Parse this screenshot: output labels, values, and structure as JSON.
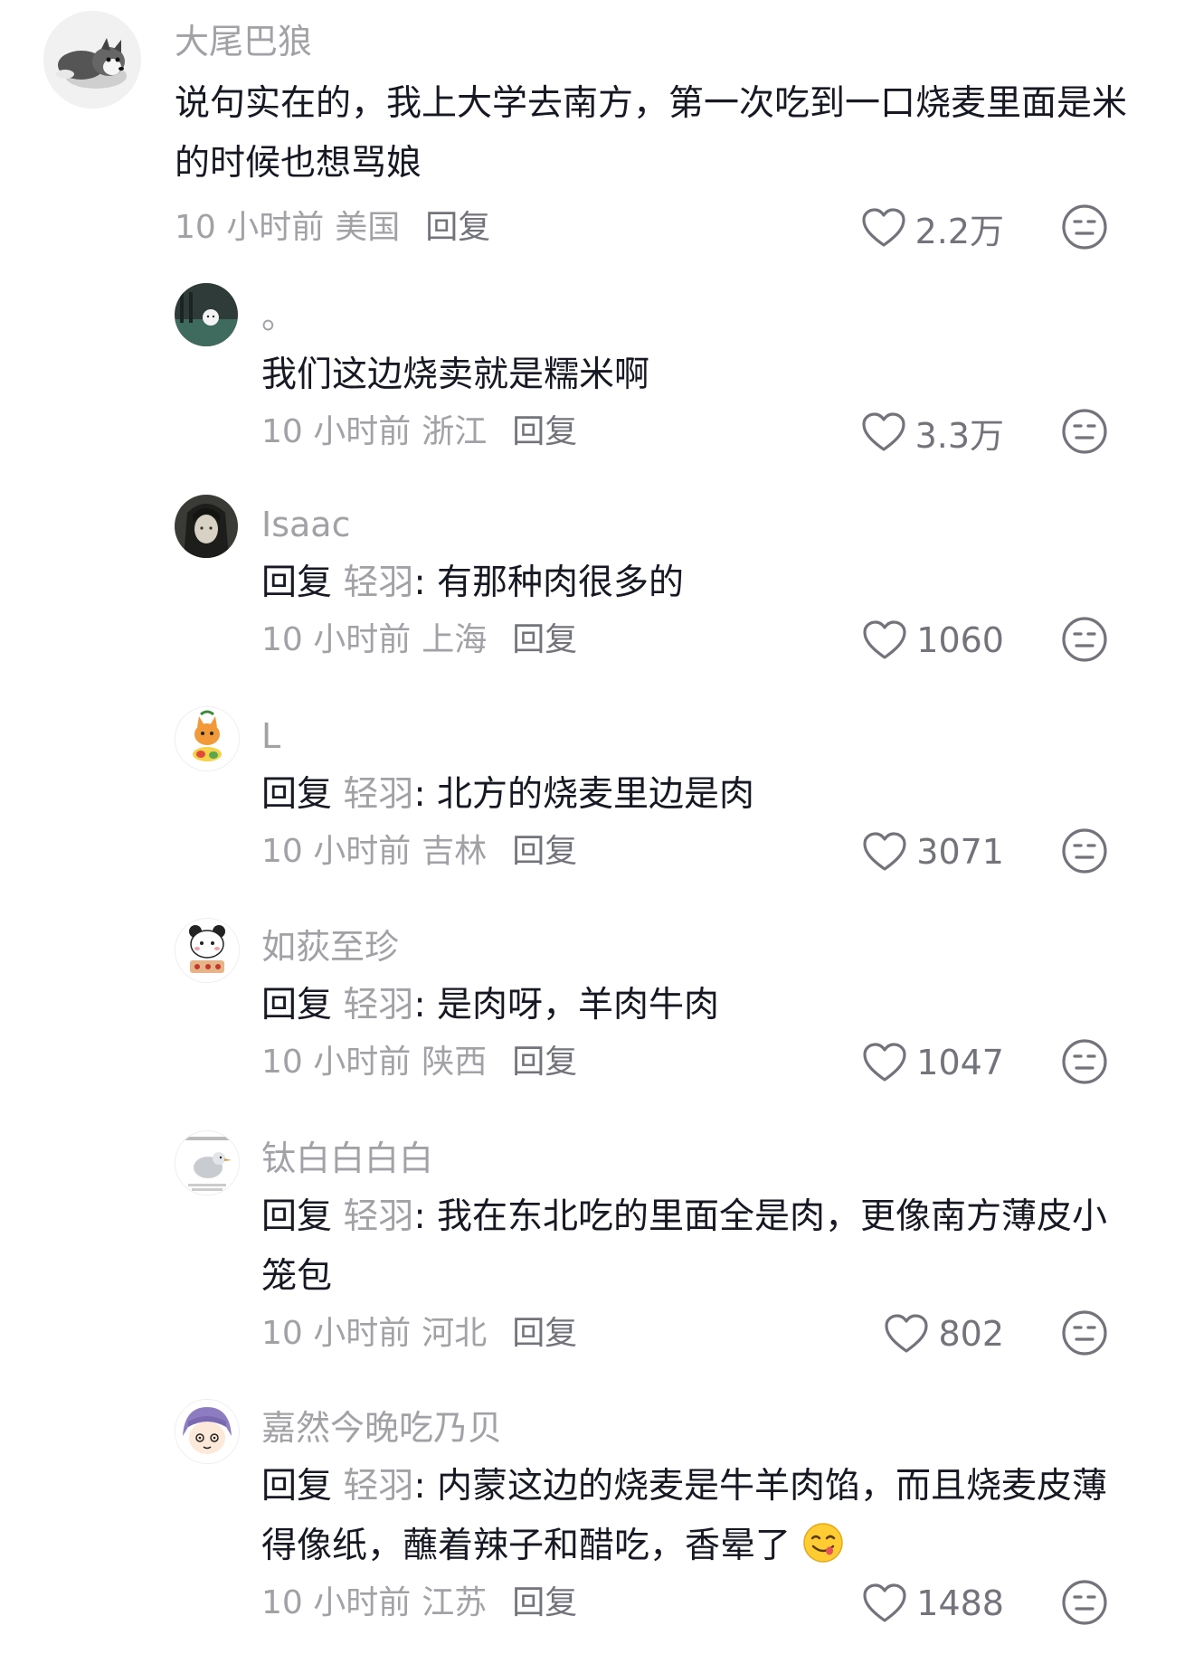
{
  "comments": [
    {
      "username": "大尾巴狼",
      "text": "说句实在的，我上大学去南方，第一次吃到一口烧麦里面是米的时候也想骂娘",
      "time": "10 小时前",
      "location": "美国",
      "reply_label": "回复",
      "likes": "2.2万",
      "avatar_icon": "husky-plush-avatar"
    },
    {
      "username": "。",
      "text": "我们这边烧卖就是糯米啊",
      "time": "10 小时前",
      "location": "浙江",
      "reply_label": "回复",
      "likes": "3.3万",
      "avatar_icon": "dark-room-avatar"
    },
    {
      "username": "Isaac",
      "reply_prefix": "回复",
      "reply_to": "轻羽",
      "colon": ":",
      "text": "有那种肉很多的",
      "time": "10 小时前",
      "location": "上海",
      "reply_label": "回复",
      "likes": "1060",
      "avatar_icon": "anime-girl-avatar"
    },
    {
      "username": "L",
      "reply_prefix": "回复",
      "reply_to": "轻羽",
      "colon": ":",
      "text": "北方的烧麦里边是肉",
      "time": "10 小时前",
      "location": "吉林",
      "reply_label": "回复",
      "likes": "3071",
      "avatar_icon": "orange-cat-avatar"
    },
    {
      "username": "如荻至珍",
      "reply_prefix": "回复",
      "reply_to": "轻羽",
      "colon": ":",
      "text": "是肉呀，羊肉牛肉",
      "time": "10 小时前",
      "location": "陕西",
      "reply_label": "回复",
      "likes": "1047",
      "avatar_icon": "panda-sticker-avatar"
    },
    {
      "username": "钛白白白白",
      "reply_prefix": "回复",
      "reply_to": "轻羽",
      "colon": ":",
      "text": "我在东北吃的里面全是肉，更像南方薄皮小笼包",
      "time": "10 小时前",
      "location": "河北",
      "reply_label": "回复",
      "likes": "802",
      "avatar_icon": "bird-meme-avatar"
    },
    {
      "username": "嘉然今晚吃乃贝",
      "reply_prefix": "回复",
      "reply_to": "轻羽",
      "colon": ":",
      "text": "内蒙这边的烧麦是牛羊肉馅，而且烧麦皮薄得像纸，蘸着辣子和醋吃，香晕了",
      "emoji": "yum-face-emoji",
      "time": "10 小时前",
      "location": "江苏",
      "reply_label": "回复",
      "likes": "1488",
      "avatar_icon": "cartoon-girl-avatar"
    }
  ],
  "colors": {
    "text_primary": "#161823",
    "text_secondary": "#a1a1a6",
    "reply_button": "#73747b"
  }
}
